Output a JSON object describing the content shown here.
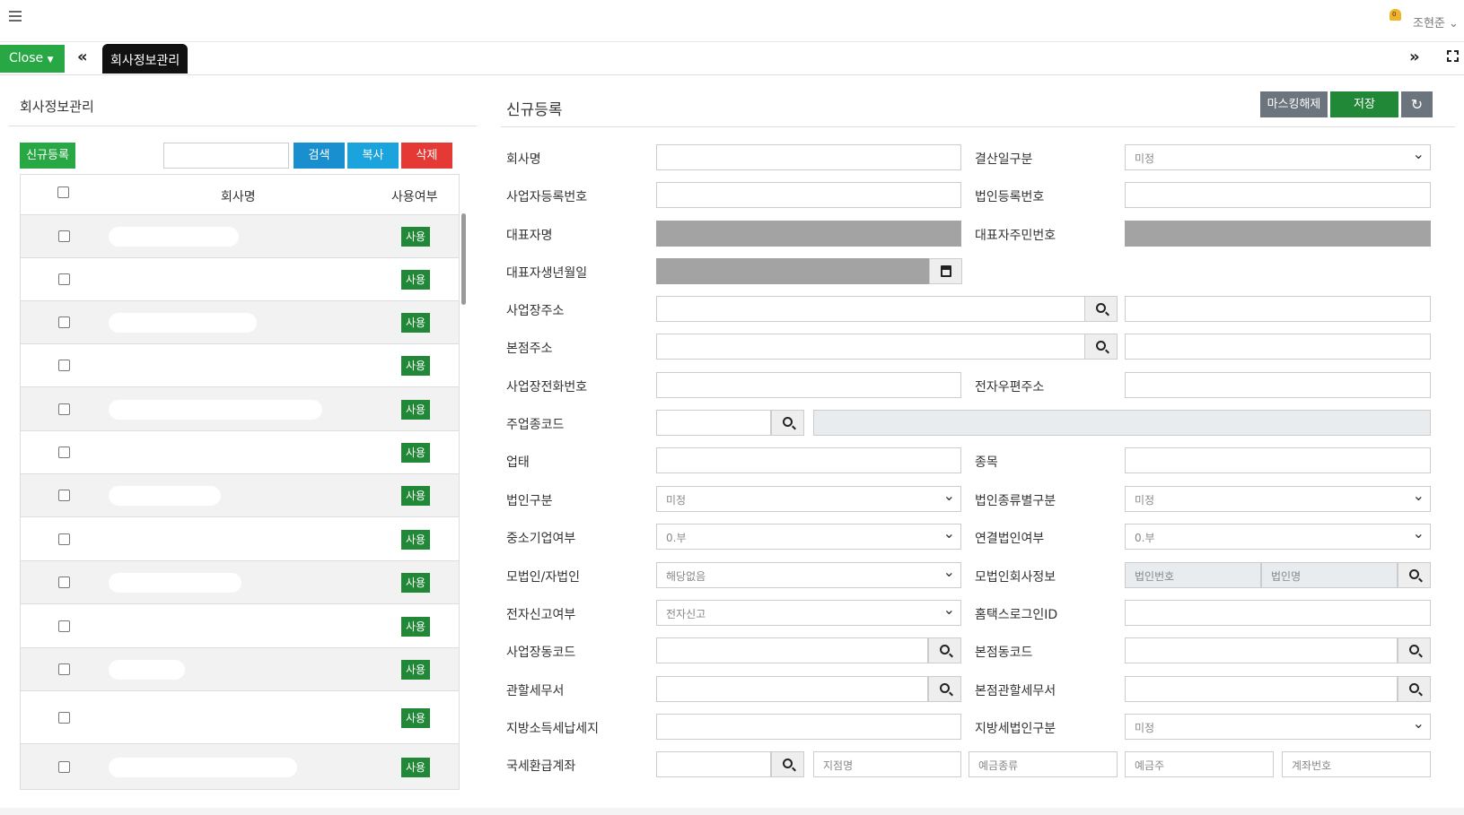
{
  "header": {
    "user_name": "조현준",
    "notif_count": "0"
  },
  "tabs": {
    "close_label": "Close",
    "active_tab": "회사정보관리"
  },
  "left": {
    "title": "회사정보관리",
    "new_label": "신규등록",
    "search_label": "검색",
    "copy_label": "복사",
    "delete_label": "삭제",
    "columns": {
      "name": "회사명",
      "use": "사용여부"
    },
    "rows": [
      {
        "name": "",
        "use": "사용"
      },
      {
        "name": "",
        "use": "사용"
      },
      {
        "name": "",
        "use": "사용"
      },
      {
        "name": "",
        "use": "사용"
      },
      {
        "name": "",
        "use": "사용"
      },
      {
        "name": "",
        "use": "사용"
      },
      {
        "name": "",
        "use": "사용"
      },
      {
        "name": "",
        "use": "사용"
      },
      {
        "name": "",
        "use": "사용"
      },
      {
        "name": "",
        "use": "사용"
      },
      {
        "name": "",
        "use": "사용"
      },
      {
        "name": "",
        "use": "사용"
      },
      {
        "name": "",
        "use": "사용"
      }
    ]
  },
  "right": {
    "title": "신규등록",
    "unmask_label": "마스킹해제",
    "save_label": "저장",
    "fields": {
      "company_name": "회사명",
      "closing_type": "결산일구분",
      "closing_type_value": "미정",
      "biz_reg_no": "사업자등록번호",
      "corp_reg_no": "법인등록번호",
      "ceo_name": "대표자명",
      "ceo_rrn": "대표자주민번호",
      "ceo_birth": "대표자생년월일",
      "biz_address": "사업장주소",
      "hq_address": "본점주소",
      "biz_phone": "사업장전화번호",
      "email": "전자우편주소",
      "industry_code": "주업종코드",
      "business_type": "업태",
      "business_item": "종목",
      "corp_type": "법인구분",
      "corp_type_value": "미정",
      "corp_kind": "법인종류별구분",
      "corp_kind_value": "미정",
      "sme": "중소기업여부",
      "sme_value": "0.부",
      "consolidated": "연결법인여부",
      "consolidated_value": "0.부",
      "parent_sub": "모법인/자법인",
      "parent_sub_value": "해당없음",
      "parent_info": "모법인회사정보",
      "parent_info_no_placeholder": "법인번호",
      "parent_info_name_placeholder": "법인명",
      "e_filing": "전자신고여부",
      "e_filing_value": "전자신고",
      "hometax_id": "홈택스로그인ID",
      "biz_dong_code": "사업장동코드",
      "hq_dong_code": "본점동코드",
      "tax_office": "관할세무서",
      "hq_tax_office": "본점관할세무서",
      "local_tax_place": "지방소득세납세지",
      "local_corp_type": "지방세법인구분",
      "local_corp_type_value": "미정",
      "refund_account": "국세환급계좌",
      "branch_placeholder": "지점명",
      "deposit_type_placeholder": "예금종류",
      "depositor_placeholder": "예금주",
      "account_no_placeholder": "계좌번호"
    }
  },
  "colors": {
    "green": "#28a745",
    "blue": "#1a8fd0",
    "red": "#e53935",
    "gray": "#6c757d"
  }
}
